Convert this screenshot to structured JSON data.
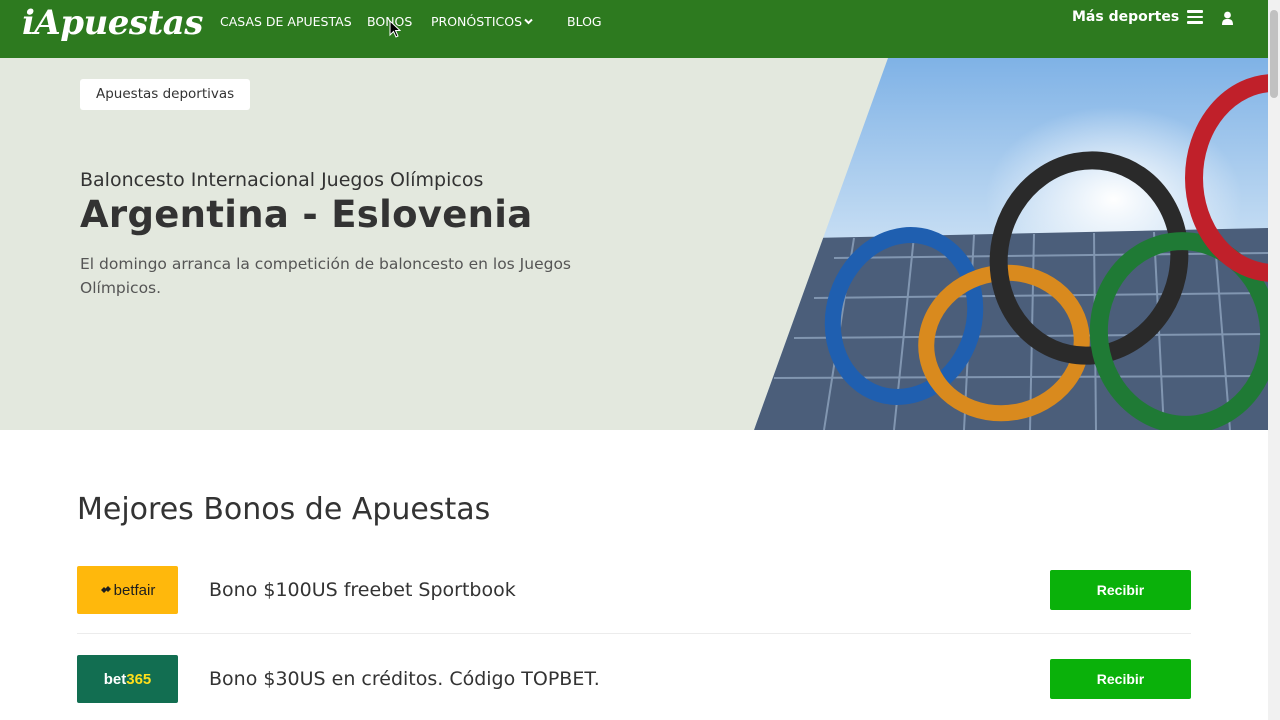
{
  "header": {
    "logo": "iApuestas",
    "nav": [
      {
        "label": "CASAS DE APUESTAS"
      },
      {
        "label": "BONOS"
      },
      {
        "label": "PRONÓSTICOS"
      },
      {
        "label": "BLOG"
      }
    ],
    "more_sports": "Más deportes"
  },
  "hero": {
    "tag": "Apuestas deportivas",
    "subtitle": "Baloncesto Internacional Juegos Olímpicos",
    "title": "Argentina - Eslovenia",
    "description": "El domingo arranca la competición de baloncesto en los Juegos Olímpicos."
  },
  "bonuses": {
    "title": "Mejores Bonos de Apuestas",
    "items": [
      {
        "brand": "betfair",
        "text": "Bono $100US freebet Sportbook",
        "button": "Recibir"
      },
      {
        "brand_a": "bet",
        "brand_b": "365",
        "text": "Bono $30US en créditos. Código TOPBET.",
        "button": "Recibir"
      }
    ]
  },
  "colors": {
    "header_bg": "#2d7a1f",
    "hero_bg": "#e3e8de",
    "button": "#0ab10a",
    "betfair": "#ffb80c",
    "bet365": "#126e51"
  },
  "icons": {
    "menu": "hamburger-icon",
    "user": "user-icon",
    "dropdown": "chevron-down-icon",
    "betfair_mark": "diamond-icon"
  }
}
